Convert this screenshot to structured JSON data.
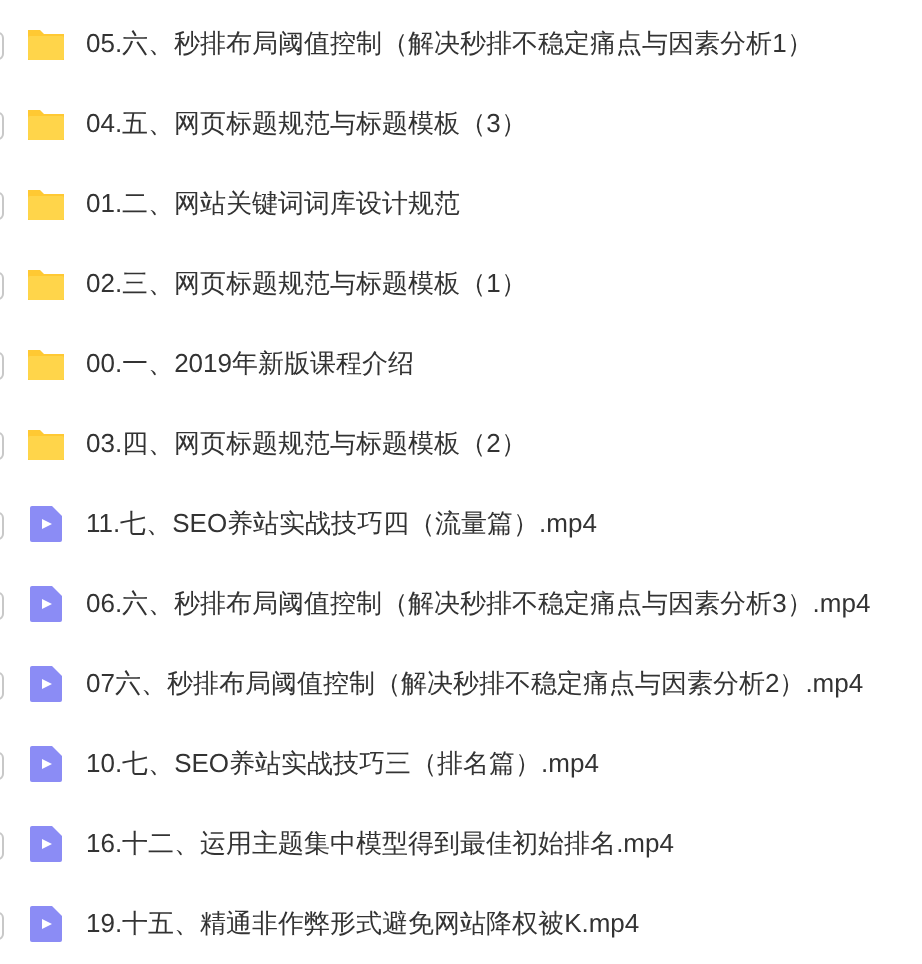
{
  "files": [
    {
      "kind": "folder",
      "name": "05.六、秒排布局阈值控制（解决秒排不稳定痛点与因素分析1）",
      "checked": false
    },
    {
      "kind": "folder",
      "name": "04.五、网页标题规范与标题模板（3）",
      "checked": false
    },
    {
      "kind": "folder",
      "name": "01.二、网站关键词词库设计规范",
      "checked": false
    },
    {
      "kind": "folder",
      "name": "02.三、网页标题规范与标题模板（1）",
      "checked": false
    },
    {
      "kind": "folder",
      "name": "00.一、2019年新版课程介绍",
      "checked": false
    },
    {
      "kind": "folder",
      "name": "03.四、网页标题规范与标题模板（2）",
      "checked": false
    },
    {
      "kind": "video",
      "name": "11.七、SEO养站实战技巧四（流量篇）.mp4",
      "checked": false
    },
    {
      "kind": "video",
      "name": "06.六、秒排布局阈值控制（解决秒排不稳定痛点与因素分析3）.mp4",
      "checked": false
    },
    {
      "kind": "video",
      "name": "07六、秒排布局阈值控制（解决秒排不稳定痛点与因素分析2）.mp4",
      "checked": false
    },
    {
      "kind": "video",
      "name": "10.七、SEO养站实战技巧三（排名篇）.mp4",
      "checked": false
    },
    {
      "kind": "video",
      "name": "16.十二、运用主题集中模型得到最佳初始排名.mp4",
      "checked": false
    },
    {
      "kind": "video",
      "name": "19.十五、精通非作弊形式避免网站降权被K.mp4",
      "checked": false
    }
  ]
}
